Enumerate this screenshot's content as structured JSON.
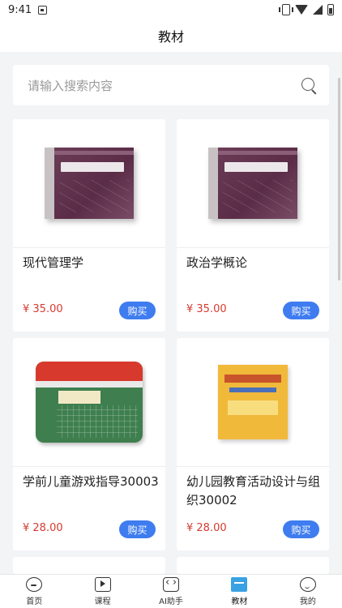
{
  "status_bar": {
    "time": "9:41"
  },
  "header": {
    "title": "教材"
  },
  "search": {
    "placeholder": "请输入搜索内容"
  },
  "products": [
    {
      "title": "现代管理学",
      "price": "¥ 35.00",
      "buy_label": "购买",
      "cover": "purple-textbook"
    },
    {
      "title": "政治学概论",
      "price": "¥ 35.00",
      "buy_label": "购买",
      "cover": "purple-textbook"
    },
    {
      "title": "学前儿童游戏指导30003",
      "price": "¥ 28.00",
      "buy_label": "购买",
      "cover": "green-red-textbook"
    },
    {
      "title": "幼儿园教育活动设计与组织30002",
      "price": "¥ 28.00",
      "buy_label": "购买",
      "cover": "yellow-textbook"
    }
  ],
  "tabs": [
    {
      "label": "首页",
      "icon": "home-face-icon"
    },
    {
      "label": "课程",
      "icon": "course-play-icon"
    },
    {
      "label": "AI助手",
      "icon": "ai-assistant-icon"
    },
    {
      "label": "教材",
      "icon": "book-icon",
      "active": true
    },
    {
      "label": "我的",
      "icon": "profile-face-icon"
    }
  ],
  "colors": {
    "accent": "#3e7cf0",
    "price": "#d63a2f",
    "background": "#f3f4f6"
  }
}
